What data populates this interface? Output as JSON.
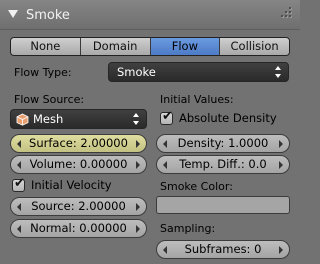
{
  "panel": {
    "title": "Smoke",
    "collapse_icon": "triangle-down-icon",
    "grip_icon": "drag-grip-icon"
  },
  "tabs": [
    {
      "label": "None",
      "active": false
    },
    {
      "label": "Domain",
      "active": false
    },
    {
      "label": "Flow",
      "active": true
    },
    {
      "label": "Collision",
      "active": false
    }
  ],
  "flow_type": {
    "label": "Flow Type:",
    "value": "Smoke"
  },
  "flow_source": {
    "label": "Flow Source:",
    "value": "Mesh",
    "icon": "mesh-cube-icon",
    "surface": "Surface: 2.00000",
    "volume": "Volume: 0.00000"
  },
  "initial_velocity": {
    "label": "Initial Velocity",
    "checked": true,
    "source": "Source: 2.00000",
    "normal": "Normal: 0.00000"
  },
  "initial_values": {
    "label": "Initial Values:",
    "absolute_density_label": "Absolute Density",
    "absolute_density_checked": true,
    "density": "Density: 1.0000",
    "temp_diff": "Temp. Diff.: 0.0"
  },
  "smoke_color": {
    "label": "Smoke Color:",
    "color": "#a5a5a5"
  },
  "sampling": {
    "label": "Sampling:",
    "subframes": "Subframes: 0"
  },
  "colors": {
    "panel_bg": "#727272",
    "active_tab": "#5a88d4",
    "highlight_field": "#d2d194"
  }
}
